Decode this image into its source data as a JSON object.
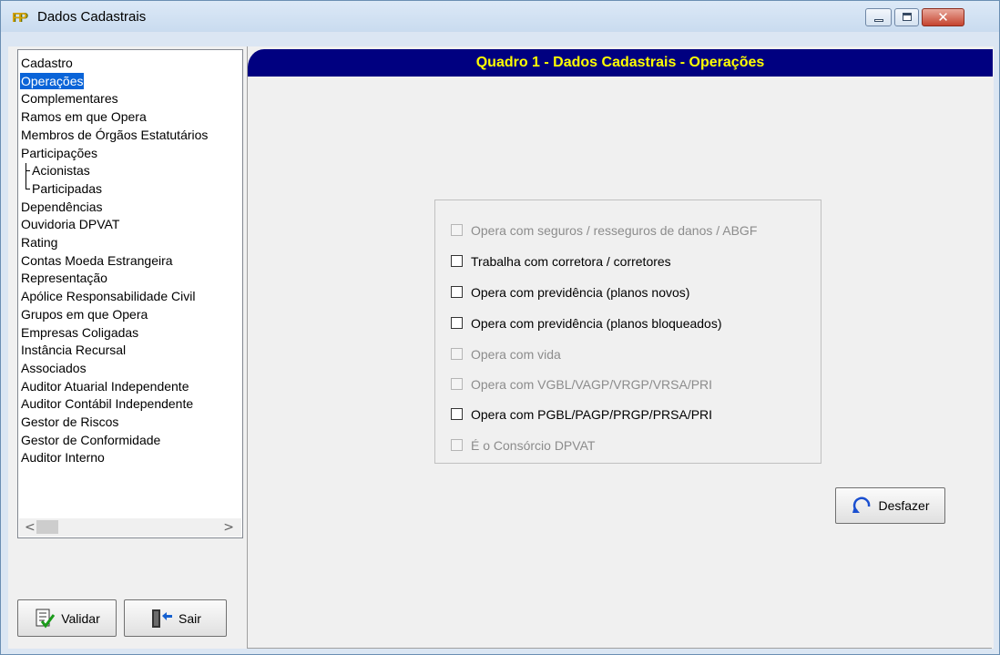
{
  "window": {
    "title": "Dados Cadastrais",
    "icon": "app-logo-icon",
    "controls": [
      "minimize",
      "maximize",
      "close"
    ]
  },
  "sidebar": {
    "items": [
      {
        "label": "Cadastro",
        "selected": false
      },
      {
        "label": "Operações",
        "selected": true
      },
      {
        "label": "Complementares",
        "selected": false
      },
      {
        "label": "Ramos em que Opera",
        "selected": false
      },
      {
        "label": "Membros de Órgãos Estatutários",
        "selected": false
      },
      {
        "label": "Participações",
        "selected": false
      },
      {
        "label": "Acionistas",
        "selected": false,
        "child": true
      },
      {
        "label": "Participadas",
        "selected": false,
        "child": true
      },
      {
        "label": "Dependências",
        "selected": false
      },
      {
        "label": "Ouvidoria DPVAT",
        "selected": false
      },
      {
        "label": "Rating",
        "selected": false
      },
      {
        "label": "Contas Moeda Estrangeira",
        "selected": false
      },
      {
        "label": "Representação",
        "selected": false
      },
      {
        "label": "Apólice Responsabilidade Civil",
        "selected": false
      },
      {
        "label": "Grupos em que Opera",
        "selected": false
      },
      {
        "label": "Empresas Coligadas",
        "selected": false
      },
      {
        "label": "Instância Recursal",
        "selected": false
      },
      {
        "label": "Associados",
        "selected": false
      },
      {
        "label": "Auditor Atuarial Independente",
        "selected": false
      },
      {
        "label": "Auditor Contábil Independente",
        "selected": false
      },
      {
        "label": "Gestor de Riscos",
        "selected": false
      },
      {
        "label": "Gestor de Conformidade",
        "selected": false
      },
      {
        "label": "Auditor Interno",
        "selected": false
      }
    ],
    "scroll_left_glyph": "<",
    "scroll_right_glyph": ">"
  },
  "header": {
    "title": "Quadro 1 - Dados Cadastrais - Operações",
    "background": "#000080",
    "text_color": "#ffff00"
  },
  "options": [
    {
      "label": "Opera com seguros / resseguros de danos / ABGF",
      "enabled": false,
      "checked": false
    },
    {
      "label": "Trabalha com corretora / corretores",
      "enabled": true,
      "checked": false
    },
    {
      "label": "Opera com previdência (planos novos)",
      "enabled": true,
      "checked": false
    },
    {
      "label": "Opera com previdência (planos bloqueados)",
      "enabled": true,
      "checked": false
    },
    {
      "label": "Opera com vida",
      "enabled": false,
      "checked": false
    },
    {
      "label": "Opera com VGBL/VAGP/VRGP/VRSA/PRI",
      "enabled": false,
      "checked": false
    },
    {
      "label": "Opera com PGBL/PAGP/PRGP/PRSA/PRI",
      "enabled": true,
      "checked": false
    },
    {
      "label": "É o Consórcio DPVAT",
      "enabled": false,
      "checked": false
    }
  ],
  "buttons": {
    "undo": {
      "label": "Desfazer",
      "icon": "undo-arrow-icon"
    },
    "validate": {
      "label": "Validar",
      "icon": "checklist-icon"
    },
    "exit": {
      "label": "Sair",
      "icon": "exit-door-icon"
    }
  },
  "colors": {
    "selection": "#0a64d8",
    "disabled_text": "#8c8c8c"
  }
}
